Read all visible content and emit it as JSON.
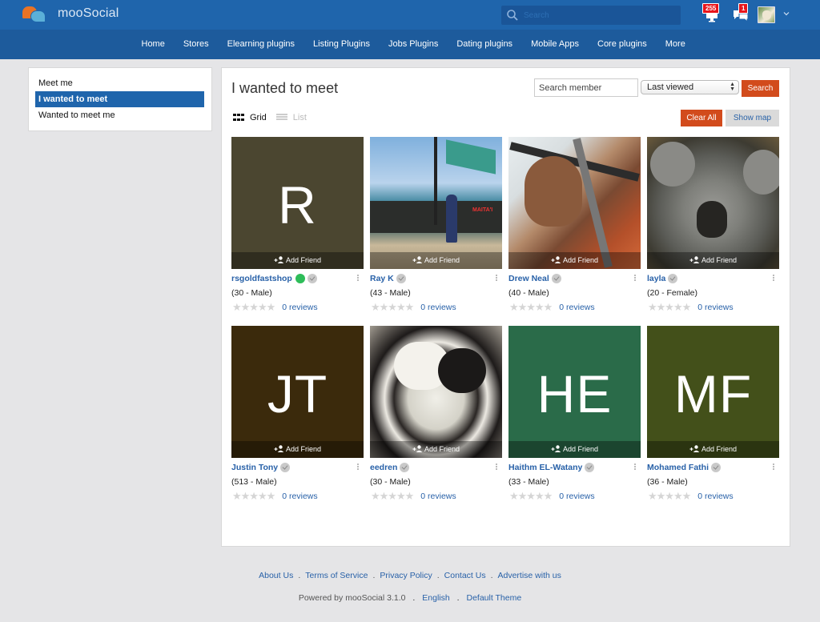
{
  "header": {
    "brand": "mooSocial",
    "search_placeholder": "Search",
    "notifications_count": "255",
    "messages_count": "1"
  },
  "nav": {
    "items": [
      "Home",
      "Stores",
      "Elearning plugins",
      "Listing Plugins",
      "Jobs Plugins",
      "Dating plugins",
      "Mobile Apps",
      "Core plugins",
      "More"
    ]
  },
  "sidebar": {
    "items": [
      {
        "label": "Meet me",
        "active": false
      },
      {
        "label": "I wanted to meet",
        "active": true
      },
      {
        "label": "Wanted to meet me",
        "active": false
      }
    ]
  },
  "main": {
    "title": "I wanted to meet",
    "search_member_placeholder": "Search member",
    "sort_selected": "Last viewed",
    "search_button": "Search",
    "clear_all_button": "Clear All",
    "show_map_button": "Show map",
    "view_grid_label": "Grid",
    "view_list_label": "List",
    "add_friend_label": "Add Friend",
    "members": [
      {
        "name": "rsgoldfastshop",
        "age_gender": "(30 - Male)",
        "reviews": "0 reviews",
        "initials": "R",
        "avatar_color": "#4b4630",
        "online": true,
        "photo": ""
      },
      {
        "name": "Ray K",
        "age_gender": "(43 - Male)",
        "reviews": "0 reviews",
        "initials": "",
        "avatar_color": "",
        "online": false,
        "photo": "boat"
      },
      {
        "name": "Drew Neal",
        "age_gender": "(40 - Male)",
        "reviews": "0 reviews",
        "initials": "",
        "avatar_color": "",
        "online": false,
        "photo": "man"
      },
      {
        "name": "layla",
        "age_gender": "(20 - Female)",
        "reviews": "0 reviews",
        "initials": "",
        "avatar_color": "",
        "online": false,
        "photo": "koala"
      },
      {
        "name": "Justin Tony",
        "age_gender": "(513 - Male)",
        "reviews": "0 reviews",
        "initials": "JT",
        "avatar_color": "#3b2a0c",
        "online": false,
        "photo": ""
      },
      {
        "name": "eedren",
        "age_gender": "(30 - Male)",
        "reviews": "0 reviews",
        "initials": "",
        "avatar_color": "",
        "online": false,
        "photo": "cats"
      },
      {
        "name": "Haithm EL-Watany",
        "age_gender": "(33 - Male)",
        "reviews": "0 reviews",
        "initials": "HE",
        "avatar_color": "#2a6b49",
        "online": false,
        "photo": ""
      },
      {
        "name": "Mohamed Fathi",
        "age_gender": "(36 - Male)",
        "reviews": "0 reviews",
        "initials": "MF",
        "avatar_color": "#43501a",
        "online": false,
        "photo": ""
      }
    ],
    "rating_stars": "★★★★★"
  },
  "footer": {
    "links": [
      "About Us",
      "Terms of Service",
      "Privacy Policy",
      "Contact Us",
      "Advertise with us"
    ],
    "powered_by": "Powered by mooSocial 3.1.0",
    "language": "English",
    "theme": "Default Theme",
    "separator": "."
  },
  "colors": {
    "header_bg": "#1f65ac",
    "nav_bg": "#1d5b9c",
    "accent_red": "#d24b1c",
    "link_blue": "#2861a8",
    "badge_red": "#e8151b",
    "online_green": "#2ebd59"
  }
}
